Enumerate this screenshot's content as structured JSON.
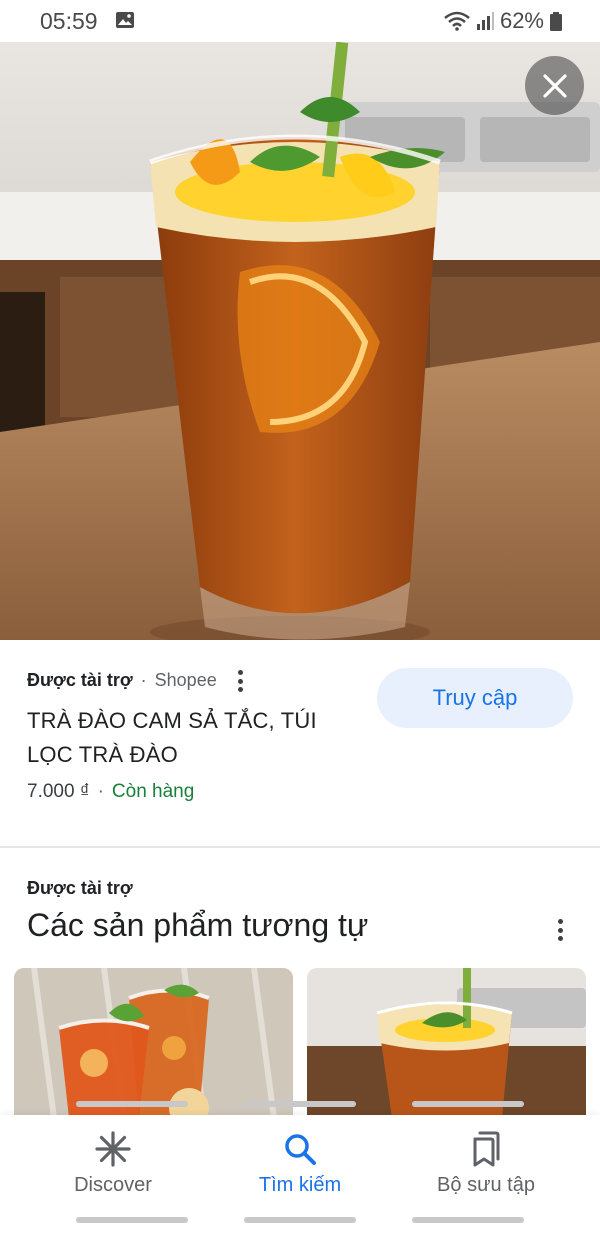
{
  "status_bar": {
    "time": "05:59",
    "battery": "62%"
  },
  "product": {
    "sponsored_label": "Được tài trợ",
    "separator": "·",
    "merchant": "Shopee",
    "title": "TRÀ ĐÀO CAM SẢ TẮC, TÚI LỌC TRÀ ĐÀO",
    "price": "7.000 ₫",
    "price_separator": "·",
    "stock_status": "Còn hàng",
    "visit_button": "Truy cập"
  },
  "similar": {
    "sponsored_label": "Được tài trợ",
    "title": "Các sản phẩm tương tự"
  },
  "bottom_nav": {
    "items": [
      {
        "label": "Discover",
        "icon": "asterisk-icon",
        "active": false
      },
      {
        "label": "Tìm kiếm",
        "icon": "search-icon",
        "active": true
      },
      {
        "label": "Bộ sưu tập",
        "icon": "collections-icon",
        "active": false
      }
    ]
  },
  "colors": {
    "accent": "#1a73e8",
    "stock_green": "#188038",
    "button_bg": "#e8f0fe"
  }
}
